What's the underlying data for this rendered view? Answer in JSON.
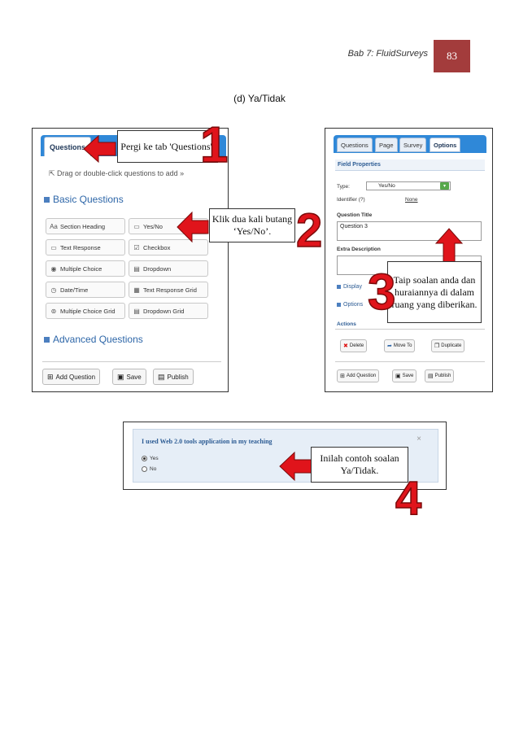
{
  "header": {
    "chapter": "Bab 7: FluidSurveys",
    "page_number": "83"
  },
  "caption": "(d) Ya/Tidak",
  "shot_questions": {
    "tabs": [
      "Questions"
    ],
    "drag_hint": "Drag or double-click questions to add »",
    "basic_title": "Basic Questions",
    "basic_items": [
      "Section Heading",
      "Yes/No",
      "Text Response",
      "Checkbox",
      "Multiple Choice",
      "Dropdown",
      "Date/Time",
      "Text Response Grid",
      "Multiple Choice Grid",
      "Dropdown Grid"
    ],
    "advanced_title": "Advanced Questions",
    "actions": [
      "Add Question",
      "Save",
      "Publish"
    ]
  },
  "shot_options": {
    "tabs": [
      "Questions",
      "Page",
      "Survey",
      "Options"
    ],
    "field_properties": "Field Properties",
    "type_label": "Type:",
    "type_value": "Yes/No",
    "identifier_label": "Identifier (?)",
    "identifier_value": "None",
    "question_title_label": "Question Title",
    "question_title_value": "Question 3",
    "extra_description_label": "Extra Description",
    "display_label": "Display",
    "options_label": "Options",
    "actions_label": "Actions",
    "action_buttons": [
      "Delete",
      "Move To",
      "Duplicate"
    ],
    "footer_buttons": [
      "Add Question",
      "Save",
      "Publish"
    ]
  },
  "shot_preview": {
    "question": "I used Web 2.0 tools application in my teaching",
    "close": "×",
    "choices": [
      "Yes",
      "No"
    ]
  },
  "callouts": {
    "step1": "Pergi ke tab 'Questions'.",
    "step2": "Klik dua kali butang ‘Yes/No’.",
    "step3": "Taip soalan anda dan huraiannya di dalam ruang yang diberikan.",
    "step4": "Inilah contoh soalan Ya/Tidak."
  },
  "step_numbers": [
    "1",
    "2",
    "3",
    "4"
  ],
  "colors": {
    "arrow_red": "#e0141b",
    "badge": "#a33c3c",
    "tab_blue": "#2f88d8",
    "link_blue": "#2d66a8"
  }
}
